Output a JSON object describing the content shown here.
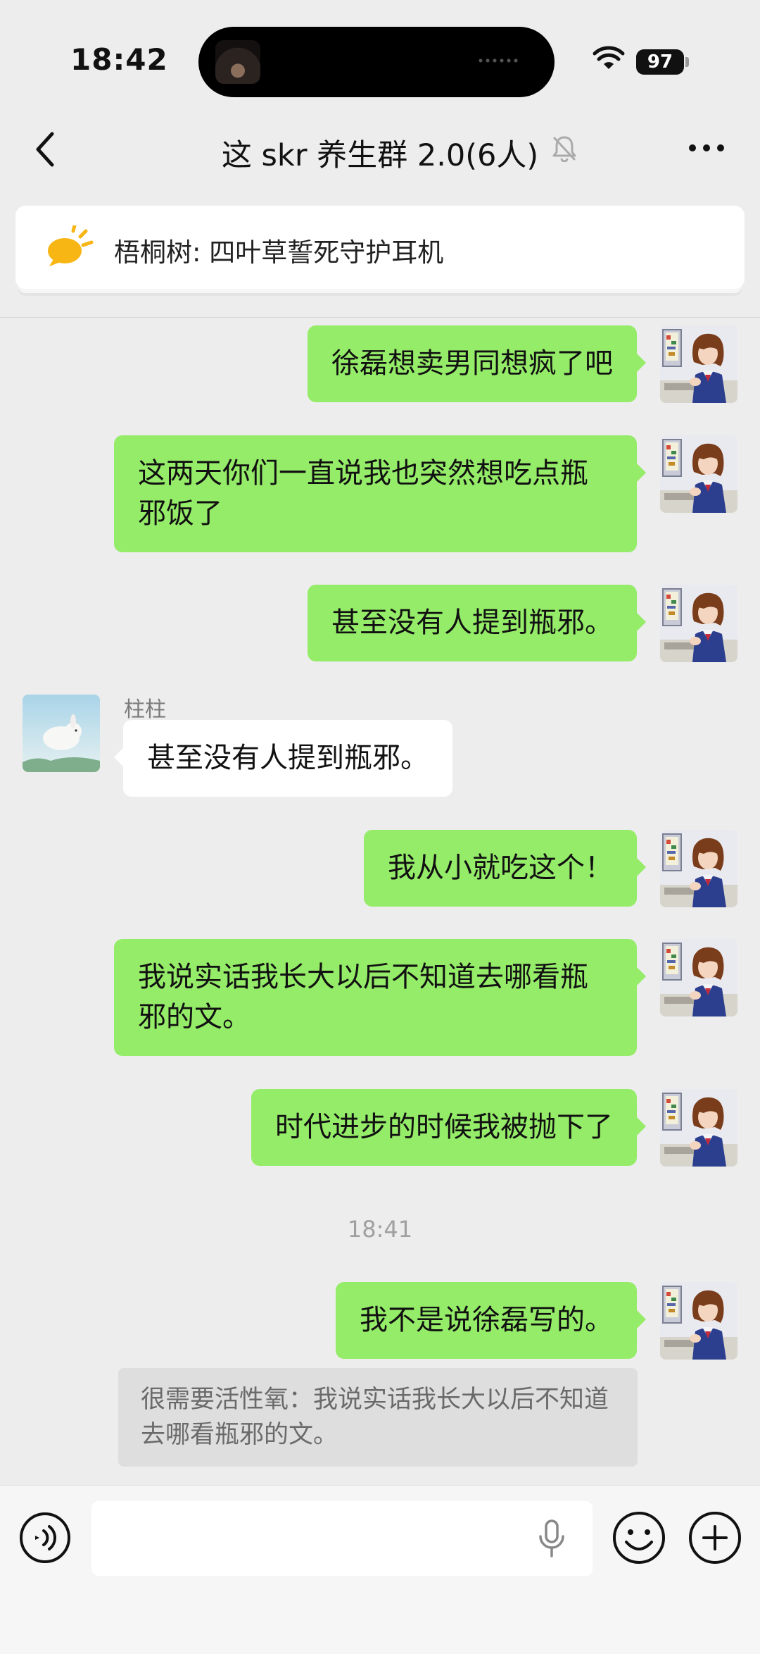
{
  "status_bar": {
    "time": "18:42",
    "battery": "97"
  },
  "header": {
    "title": "这 skr 养生群 2.0(6人)"
  },
  "pinned": {
    "text": "梧桐树: 四叶草誓死守护耳机"
  },
  "messages": [
    {
      "text": "徐磊想卖男同想疯了吧"
    },
    {
      "text": "这两天你们一直说我也突然想吃点瓶邪饭了"
    },
    {
      "text": "甚至没有人提到瓶邪。"
    },
    {
      "sender": "柱柱",
      "text": "甚至没有人提到瓶邪。"
    },
    {
      "text": "我从小就吃这个！"
    },
    {
      "text": "我说实话我长大以后不知道去哪看瓶邪的文。"
    },
    {
      "text": "时代进步的时候我被抛下了"
    },
    {
      "text": "我不是说徐磊写的。"
    }
  ],
  "timestamp": "18:41",
  "quote": {
    "text": "很需要活性氧：我说实话我长大以后不知道去哪看瓶邪的文。"
  },
  "input": {
    "value": "",
    "placeholder": ""
  },
  "icons": {
    "back": "chevron-left-icon",
    "mute": "bell-off-icon",
    "more": "more-dots-icon",
    "megaphone": "megaphone-icon",
    "voice": "voice-icon",
    "mic": "microphone-icon",
    "emoji": "emoji-icon",
    "add": "plus-icon"
  },
  "colors": {
    "outgoing_bubble": "#95ec69",
    "incoming_bubble": "#ffffff",
    "background": "#ededed",
    "pinned_icon": "#f7b614"
  }
}
